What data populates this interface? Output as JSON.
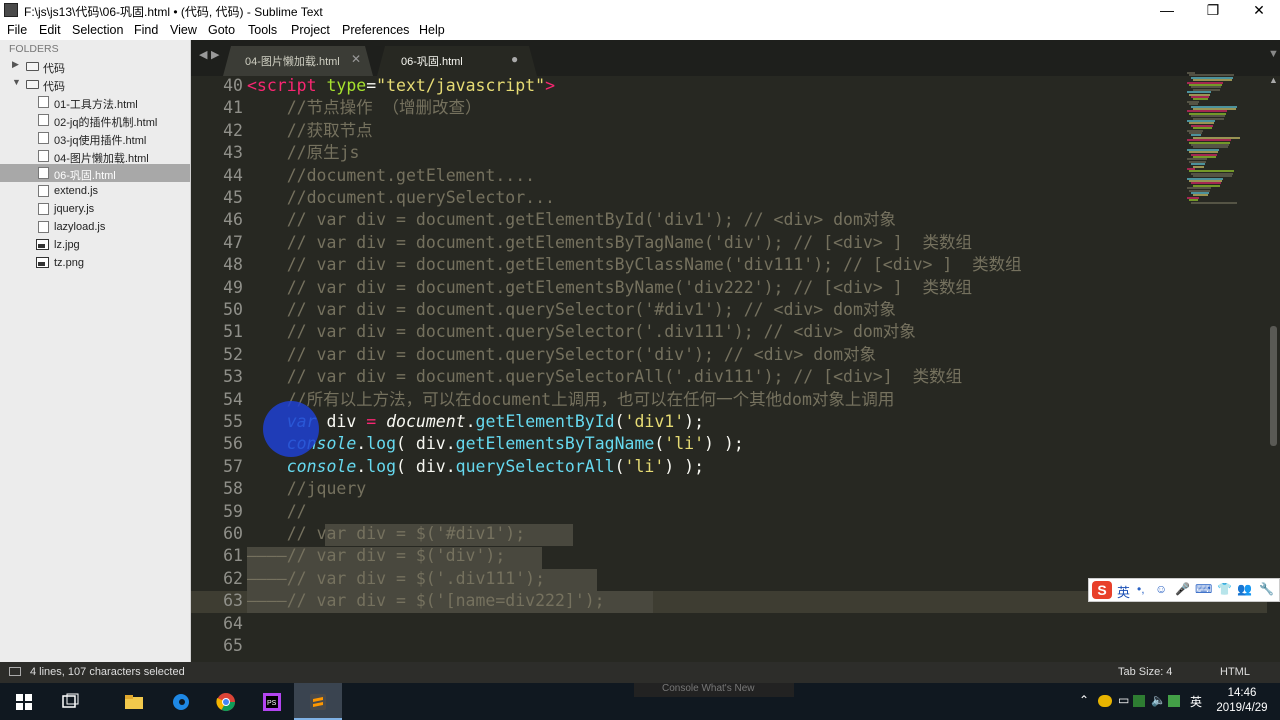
{
  "window": {
    "title": "F:\\js\\js13\\代码\\06-巩固.html • (代码, 代码) - Sublime Text",
    "controls": [
      "—",
      "❐",
      "✕"
    ]
  },
  "menu": [
    "File",
    "Edit",
    "Selection",
    "Find",
    "View",
    "Goto",
    "Tools",
    "Project",
    "Preferences",
    "Help"
  ],
  "sidebar": {
    "header": "FOLDERS",
    "items": [
      {
        "label": "代码",
        "type": "folder",
        "state": "collapsed",
        "depth": 0
      },
      {
        "label": "代码",
        "type": "folder",
        "state": "expanded",
        "depth": 0
      },
      {
        "label": "01-工具方法.html",
        "type": "file",
        "depth": 1
      },
      {
        "label": "02-jq的插件机制.html",
        "type": "file",
        "depth": 1
      },
      {
        "label": "03-jq使用插件.html",
        "type": "file",
        "depth": 1
      },
      {
        "label": "04-图片懒加载.html",
        "type": "file",
        "depth": 1
      },
      {
        "label": "06-巩固.html",
        "type": "file",
        "depth": 1,
        "active": true
      },
      {
        "label": "extend.js",
        "type": "file",
        "depth": 1
      },
      {
        "label": "jquery.js",
        "type": "file",
        "depth": 1
      },
      {
        "label": "lazyload.js",
        "type": "file",
        "depth": 1
      },
      {
        "label": "lz.jpg",
        "type": "image",
        "depth": 1
      },
      {
        "label": "tz.png",
        "type": "image",
        "depth": 1
      }
    ]
  },
  "tabs": {
    "nav": [
      "◀",
      "▶"
    ],
    "items": [
      {
        "label": "04-图片懒加载.html",
        "close": "✕",
        "active": false
      },
      {
        "label": "06-巩固.html",
        "close": "●",
        "active": true
      }
    ]
  },
  "editor": {
    "lines": [
      {
        "n": "40",
        "tokens": [
          [
            "tag",
            "<script "
          ],
          [
            "attr",
            "type"
          ],
          [
            "p",
            "="
          ],
          [
            "str",
            "\"text/javascript\""
          ],
          [
            "tag",
            ">"
          ]
        ]
      },
      {
        "n": "41",
        "tokens": [
          [
            "p",
            "    "
          ],
          [
            "c",
            "//节点操作 （增删改查）"
          ]
        ]
      },
      {
        "n": "42",
        "tokens": [
          [
            "p",
            "    "
          ],
          [
            "c",
            "//获取节点"
          ]
        ]
      },
      {
        "n": "43",
        "tokens": [
          [
            "p",
            "    "
          ],
          [
            "c",
            "//原生js"
          ]
        ]
      },
      {
        "n": "44",
        "tokens": [
          [
            "p",
            "    "
          ],
          [
            "c",
            "//document.getElement...."
          ]
        ]
      },
      {
        "n": "45",
        "tokens": [
          [
            "p",
            "    "
          ],
          [
            "c",
            "//document.querySelector..."
          ]
        ]
      },
      {
        "n": "46",
        "tokens": [
          [
            "p",
            "    "
          ],
          [
            "c",
            "// var div = document.getElementById('div1'); // <div> dom对象"
          ]
        ]
      },
      {
        "n": "47",
        "tokens": [
          [
            "p",
            "    "
          ],
          [
            "c",
            "// var div = document.getElementsByTagName('div'); // [<div> ]  类数组"
          ]
        ]
      },
      {
        "n": "48",
        "tokens": [
          [
            "p",
            "    "
          ],
          [
            "c",
            "// var div = document.getElementsByClassName('div111'); // [<div> ]  类数组"
          ]
        ]
      },
      {
        "n": "49",
        "tokens": [
          [
            "p",
            "    "
          ],
          [
            "c",
            "// var div = document.getElementsByName('div222'); // [<div> ]  类数组"
          ]
        ]
      },
      {
        "n": "50",
        "tokens": [
          [
            "p",
            "    "
          ],
          [
            "c",
            "// var div = document.querySelector('#div1'); // <div> dom对象"
          ]
        ]
      },
      {
        "n": "51",
        "tokens": [
          [
            "p",
            "    "
          ],
          [
            "c",
            "// var div = document.querySelector('.div111'); // <div> dom对象"
          ]
        ]
      },
      {
        "n": "52",
        "tokens": [
          [
            "p",
            "    "
          ],
          [
            "c",
            "// var div = document.querySelector('div'); // <div> dom对象"
          ]
        ]
      },
      {
        "n": "53",
        "tokens": [
          [
            "p",
            "    "
          ],
          [
            "c",
            "// var div = document.querySelectorAll('.div111'); // [<div>]  类数组"
          ]
        ]
      },
      {
        "n": "54",
        "tokens": [
          [
            "p",
            "    "
          ],
          [
            "c",
            "//所有以上方法，可以在document上调用，也可以在任何一个其他dom对象上调用"
          ]
        ]
      },
      {
        "n": "55",
        "tokens": [
          [
            "p",
            "    "
          ],
          [
            "kw",
            "var"
          ],
          [
            "p",
            " div "
          ],
          [
            "tag",
            "="
          ],
          [
            "p",
            " "
          ],
          [
            "ital",
            "document"
          ],
          [
            "p",
            "."
          ],
          [
            "fn",
            "getElementById"
          ],
          [
            "p",
            "("
          ],
          [
            "str",
            "'div1'"
          ],
          [
            "p",
            ");"
          ]
        ]
      },
      {
        "n": "56",
        "tokens": [
          [
            "p",
            "    "
          ],
          [
            "kw",
            "console"
          ],
          [
            "p",
            "."
          ],
          [
            "fn",
            "log"
          ],
          [
            "p",
            "( div."
          ],
          [
            "fn",
            "getElementsByTagName"
          ],
          [
            "p",
            "("
          ],
          [
            "str",
            "'li'"
          ],
          [
            "p",
            ") );"
          ]
        ]
      },
      {
        "n": "57",
        "tokens": [
          [
            "p",
            "    "
          ],
          [
            "kw",
            "console"
          ],
          [
            "p",
            "."
          ],
          [
            "fn",
            "log"
          ],
          [
            "p",
            "( div."
          ],
          [
            "fn",
            "querySelectorAll"
          ],
          [
            "p",
            "("
          ],
          [
            "str",
            "'li'"
          ],
          [
            "p",
            ") );"
          ]
        ]
      },
      {
        "n": "58",
        "tokens": [
          [
            "p",
            "    "
          ],
          [
            "c",
            "//jquery"
          ]
        ]
      },
      {
        "n": "59",
        "tokens": [
          [
            "p",
            "    "
          ],
          [
            "c",
            "//"
          ]
        ]
      },
      {
        "n": "60",
        "tokens": [
          [
            "p",
            "    "
          ],
          [
            "c",
            "// "
          ],
          [
            "csel",
            "var div = $('#div1');"
          ]
        ]
      },
      {
        "n": "61",
        "tokens": [
          [
            "csel",
            "————// var div = $('div');"
          ]
        ]
      },
      {
        "n": "62",
        "tokens": [
          [
            "csel",
            "————// var div = $('.div111');"
          ]
        ]
      },
      {
        "n": "63",
        "tokens": [
          [
            "csel",
            "————// var div = $('[name=div222]');"
          ]
        ]
      },
      {
        "n": "64",
        "tokens": []
      },
      {
        "n": "65",
        "tokens": []
      }
    ]
  },
  "ime": {
    "char": "英",
    "icons": [
      "•,",
      "☺",
      "🎤",
      "⌨",
      "👕",
      "👥",
      "🔧"
    ]
  },
  "status": {
    "selection": "4 lines, 107 characters selected",
    "tab_size": "Tab Size: 4",
    "syntax": "HTML"
  },
  "taskbar": {
    "peek": "Console    What's New",
    "tray_lang": "英",
    "time": "14:46",
    "date": "2019/4/29"
  },
  "colors": {
    "bg": "#272822",
    "comment": "#75715e",
    "keyword": "#66d9ef",
    "string": "#e6db74",
    "tag": "#f92672",
    "attr": "#a6e22e",
    "selection": "#49483e"
  }
}
